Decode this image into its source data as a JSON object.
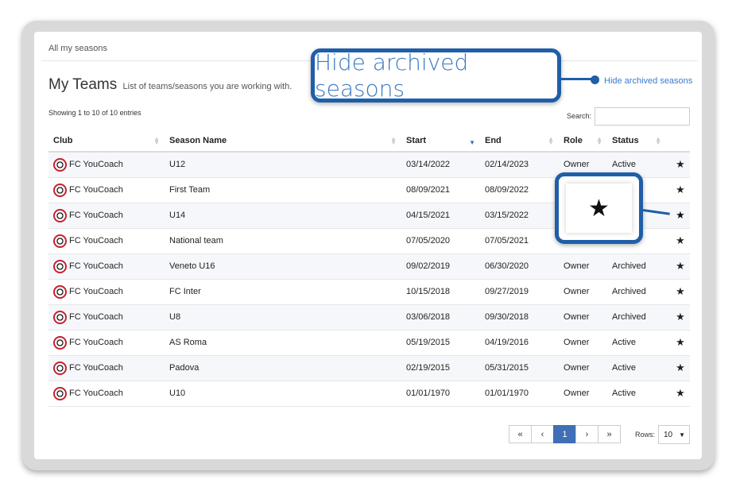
{
  "breadcrumb": "All my seasons",
  "page_title": "My Teams",
  "page_subtitle": "List of teams/seasons you are working with.",
  "hide_link": "Hide archived seasons",
  "callout_text": "Hide archived seasons",
  "showing_text": "Showing 1 to 10 of 10 entries",
  "search_label": "Search:",
  "search_value": "",
  "columns": [
    "Club",
    "Season Name",
    "Start",
    "End",
    "Role",
    "Status"
  ],
  "rows": [
    {
      "club": "FC YouCoach",
      "season": "U12",
      "start": "03/14/2022",
      "end": "02/14/2023",
      "role": "Owner",
      "status": "Active",
      "favorite": false
    },
    {
      "club": "FC YouCoach",
      "season": "First Team",
      "start": "08/09/2021",
      "end": "08/09/2022",
      "role": "",
      "status": "",
      "favorite": false
    },
    {
      "club": "FC YouCoach",
      "season": "U14",
      "start": "04/15/2021",
      "end": "03/15/2022",
      "role": "",
      "status": "",
      "favorite": true
    },
    {
      "club": "FC YouCoach",
      "season": "National team",
      "start": "07/05/2020",
      "end": "07/05/2021",
      "role": "",
      "status": "",
      "favorite": false
    },
    {
      "club": "FC YouCoach",
      "season": "Veneto U16",
      "start": "09/02/2019",
      "end": "06/30/2020",
      "role": "Owner",
      "status": "Archived",
      "favorite": false
    },
    {
      "club": "FC YouCoach",
      "season": "FC Inter",
      "start": "10/15/2018",
      "end": "09/27/2019",
      "role": "Owner",
      "status": "Archived",
      "favorite": false
    },
    {
      "club": "FC YouCoach",
      "season": "U8",
      "start": "03/06/2018",
      "end": "09/30/2018",
      "role": "Owner",
      "status": "Archived",
      "favorite": false
    },
    {
      "club": "FC YouCoach",
      "season": "AS Roma",
      "start": "05/19/2015",
      "end": "04/19/2016",
      "role": "Owner",
      "status": "Active",
      "favorite": false
    },
    {
      "club": "FC YouCoach",
      "season": "Padova",
      "start": "02/19/2015",
      "end": "05/31/2015",
      "role": "Owner",
      "status": "Active",
      "favorite": false
    },
    {
      "club": "FC YouCoach",
      "season": "U10",
      "start": "01/01/1970",
      "end": "01/01/1970",
      "role": "Owner",
      "status": "Active",
      "favorite": false
    }
  ],
  "pagination": {
    "first": "«",
    "prev": "‹",
    "current": "1",
    "next": "›",
    "last": "»"
  },
  "rows_label": "Rows:",
  "rows_value": "10",
  "colors": {
    "accent": "#3f6fb5",
    "callout": "#1f5ea8",
    "link": "#3b7ad0"
  },
  "icons": {
    "favorite": "star-icon",
    "sort": "sort-icon",
    "logo": "club-logo"
  }
}
